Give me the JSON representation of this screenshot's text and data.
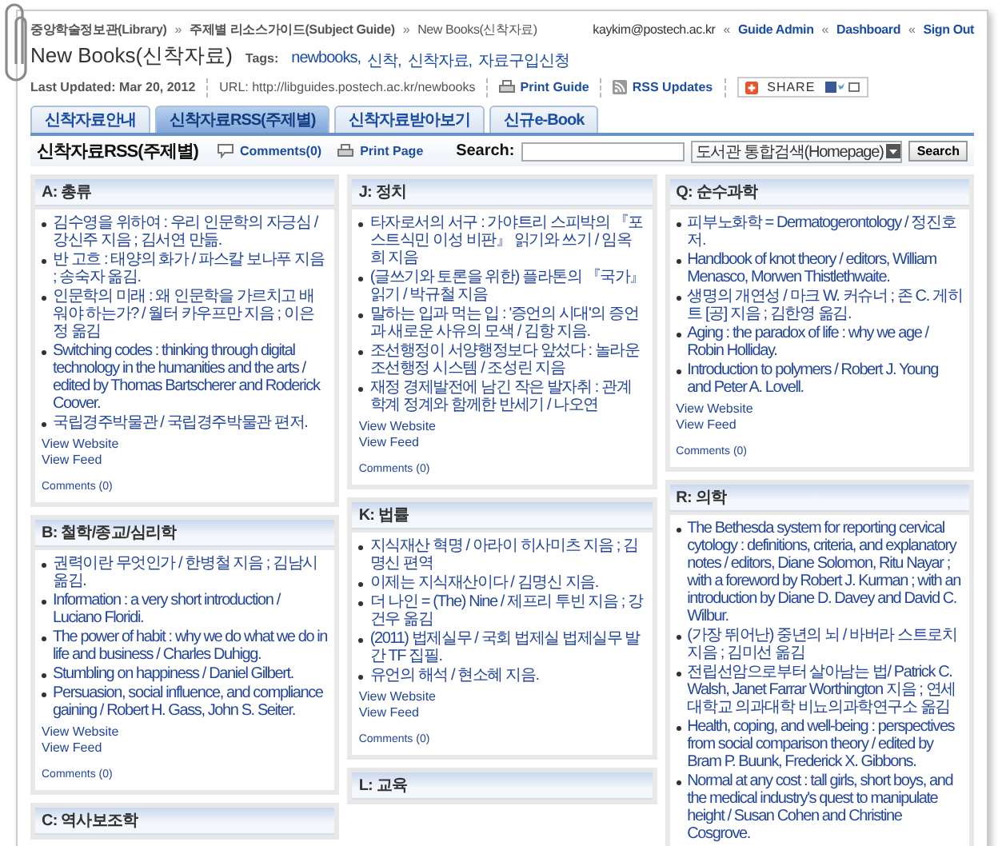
{
  "breadcrumb": [
    {
      "label": "중앙학술정보관(Library)",
      "link": true
    },
    {
      "label": "주제별 리소스가이드(Subject Guide)",
      "link": true
    },
    {
      "label": "New Books(신착자료)",
      "link": false
    }
  ],
  "breadcrumb_separator": "»",
  "user": {
    "email": "kaykim@postech.ac.kr",
    "links": [
      "Guide Admin",
      "Dashboard",
      "Sign Out"
    ],
    "separator": "«"
  },
  "guide": {
    "title": "New Books(신착자료)",
    "tags_label": "Tags:",
    "tags": [
      "newbooks",
      "신착",
      "신착자료",
      "자료구입신청"
    ],
    "tag_separator": ","
  },
  "meta": {
    "last_updated": "Last Updated: Mar 20, 2012",
    "url": "URL: http://libguides.postech.ac.kr/newbooks",
    "print_guide": "Print Guide",
    "rss_updates": "RSS Updates",
    "share": "SHARE"
  },
  "tabs": [
    {
      "label": "신착자료안내",
      "selected": false
    },
    {
      "label": "신착자료RSS(주제별)",
      "selected": true
    },
    {
      "label": "신착자료받아보기",
      "selected": false
    },
    {
      "label": "신규e-Book",
      "selected": false
    }
  ],
  "page": {
    "title": "신착자료RSS(주제별)",
    "comments": "Comments(0)",
    "print_page": "Print Page",
    "search_label": "Search:",
    "search_scope": "도서관 통합검색(Homepage)",
    "search_button": "Search"
  },
  "columns": [
    [
      {
        "title": "A: 총류",
        "items": [
          "김수영을 위하여 : 우리 인문학의 자긍심 / 강신주 지음 ; 김서연 만듦.",
          "반 고흐 : 태양의 화가 / 파스칼 보나푸 지음 ; 송숙자 옮김.",
          "인문학의 미래 : 왜 인문학을 가르치고 배워야 하는가? / 월터 카우프만 지음 ; 이은정 옮김",
          "Switching codes : thinking through digital technology in the humanities and the arts / edited by Thomas Bartscherer and Roderick Coover.",
          "국립경주박물관 / 국립경주박물관 편저."
        ],
        "links": [
          "View Website",
          "View Feed"
        ],
        "comments": "Comments (0)"
      },
      {
        "title": "B: 철학/종교/심리학",
        "items": [
          "권력이란 무엇인가 / 한병철 지음 ; 김남시 옮김.",
          "Information : a very short introduction / Luciano Floridi.",
          "The power of habit : why we do what we do in life and business / Charles Duhigg.",
          "Stumbling on happiness / Daniel Gilbert.",
          "Persuasion, social influence, and compliance gaining / Robert H. Gass, John S. Seiter."
        ],
        "links": [
          "View Website",
          "View Feed"
        ],
        "comments": "Comments (0)"
      },
      {
        "title": "C: 역사보조학"
      }
    ],
    [
      {
        "title": "J: 정치",
        "items": [
          "타자로서의 서구 : 가야트리 스피박의 『포스트식민 이성 비판』 읽기와 쓰기 / 임옥희 지음",
          "(글쓰기와 토론을 위한) 플라톤의 『국가』 읽기 / 박규철 지음",
          "말하는 입과 먹는 입 : '증언의 시대'의 증언과 새로운 사유의 모색 / 김항 지음.",
          "조선행정이 서양행정보다 앞섰다 : 놀라운 조선행정 시스템 / 조성린 지음",
          "재정 경제발전에 남긴 작은 발자취 : 관계 학계 정계와 함께한 반세기 / 나오연"
        ],
        "links": [
          "View Website",
          "View Feed"
        ],
        "comments": "Comments (0)"
      },
      {
        "title": "K: 법률",
        "items": [
          "지식재산 혁명 / 아라이 히사미츠 지음 ; 김명신 편역",
          "이제는 지식재산이다 / 김명신 지음.",
          "더 나인 = (The) Nine / 제프리 투빈 지음 ; 강건우 옮김",
          "(2011) 법제실무 / 국회 법제실 법제실무 발간 TF 집필.",
          "유언의 해석 / 현소혜 지음."
        ],
        "links": [
          "View Website",
          "View Feed"
        ],
        "comments": "Comments (0)"
      },
      {
        "title": "L: 교육"
      }
    ],
    [
      {
        "title": "Q: 순수과학",
        "items": [
          "피부노화학 = Dermatogerontology / 정진호 저.",
          "Handbook of knot theory / editors, William Menasco, Morwen Thistlethwaite.",
          "생명의 개연성 / 마크 W. 커슈너 ; 존 C. 게히트 [공] 지음 ; 김한영 옮김.",
          "Aging : the paradox of life : why we age / Robin Holliday.",
          "Introduction to polymers / Robert J. Young and Peter A. Lovell."
        ],
        "links": [
          "View Website",
          "View Feed"
        ],
        "comments": "Comments (0)"
      },
      {
        "title": "R: 의학",
        "items": [
          "The Bethesda system for reporting cervical cytology : definitions, criteria, and explanatory notes / editors, Diane Solomon, Ritu Nayar ; with a foreword by Robert J. Kurman ; with an introduction by Diane D. Davey and David C. Wilbur.",
          "(가장 뛰어난) 중년의 뇌 / 바버라 스트로치 지음 ; 김미선 옮김",
          "전립선암으로부터 살아남는 법/ Patrick C. Walsh, Janet Farrar Worthington 지음 ; 연세대학교 의과대학 비뇨의과학연구소 옮김",
          "Health, coping, and well-being : perspectives from social comparison theory / edited by Bram P. Buunk, Frederick X. Gibbons.",
          "Normal at any cost : tall girls, short boys, and the medical industry's quest to manipulate height / Susan Cohen and Christine Cosgrove."
        ]
      }
    ]
  ]
}
